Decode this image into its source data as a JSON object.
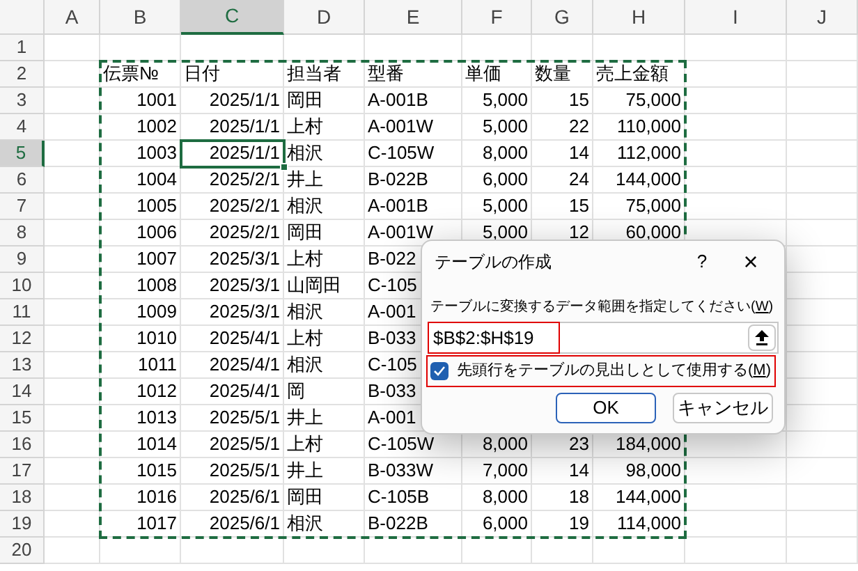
{
  "sheet": {
    "columns": [
      {
        "label": "A",
        "selected": false,
        "kind": "text"
      },
      {
        "label": "B",
        "selected": false,
        "kind": "number"
      },
      {
        "label": "C",
        "selected": true,
        "kind": "number"
      },
      {
        "label": "D",
        "selected": false,
        "kind": "text"
      },
      {
        "label": "E",
        "selected": false,
        "kind": "text"
      },
      {
        "label": "F",
        "selected": false,
        "kind": "number"
      },
      {
        "label": "G",
        "selected": false,
        "kind": "number"
      },
      {
        "label": "H",
        "selected": false,
        "kind": "number"
      },
      {
        "label": "I",
        "selected": false,
        "kind": "text"
      },
      {
        "label": "J",
        "selected": false,
        "kind": "text"
      }
    ],
    "copy_marquee": true,
    "rows": [
      {
        "header": "1",
        "selected": false,
        "kind": "data",
        "cells": []
      },
      {
        "header": "2",
        "selected": false,
        "kind": "header",
        "cells": [
          "",
          "伝票№",
          "日付",
          "担当者",
          "型番",
          "単価",
          "数量",
          "売上金額"
        ]
      },
      {
        "header": "3",
        "selected": false,
        "kind": "data",
        "cells": [
          "",
          "1001",
          "2025/1/1",
          "岡田",
          "A-001B",
          "5,000",
          "15",
          "75,000"
        ]
      },
      {
        "header": "4",
        "selected": false,
        "kind": "data",
        "cells": [
          "",
          "1002",
          "2025/1/1",
          "上村",
          "A-001W",
          "5,000",
          "22",
          "110,000"
        ]
      },
      {
        "header": "5",
        "selected": true,
        "kind": "data",
        "cells": [
          "",
          "1003",
          "2025/1/1",
          "相沢",
          "C-105W",
          "8,000",
          "14",
          "112,000"
        ]
      },
      {
        "header": "6",
        "selected": false,
        "kind": "data",
        "cells": [
          "",
          "1004",
          "2025/2/1",
          "井上",
          "B-022B",
          "6,000",
          "24",
          "144,000"
        ]
      },
      {
        "header": "7",
        "selected": false,
        "kind": "data",
        "cells": [
          "",
          "1005",
          "2025/2/1",
          "相沢",
          "A-001B",
          "5,000",
          "15",
          "75,000"
        ]
      },
      {
        "header": "8",
        "selected": false,
        "kind": "data",
        "cells": [
          "",
          "1006",
          "2025/2/1",
          "岡田",
          "A-001W",
          "5,000",
          "12",
          "60,000"
        ]
      },
      {
        "header": "9",
        "selected": false,
        "kind": "data",
        "cells": [
          "",
          "1007",
          "2025/3/1",
          "上村",
          "B-022"
        ]
      },
      {
        "header": "10",
        "selected": false,
        "kind": "data",
        "cells": [
          "",
          "1008",
          "2025/3/1",
          "山岡田",
          "C-105"
        ]
      },
      {
        "header": "11",
        "selected": false,
        "kind": "data",
        "cells": [
          "",
          "1009",
          "2025/3/1",
          "相沢",
          "A-001"
        ]
      },
      {
        "header": "12",
        "selected": false,
        "kind": "data",
        "cells": [
          "",
          "1010",
          "2025/4/1",
          "上村",
          "B-033"
        ]
      },
      {
        "header": "13",
        "selected": false,
        "kind": "data",
        "cells": [
          "",
          "1011",
          "2025/4/1",
          "相沢",
          "C-105"
        ]
      },
      {
        "header": "14",
        "selected": false,
        "kind": "data",
        "cells": [
          "",
          "1012",
          "2025/4/1",
          "岡",
          "B-033"
        ]
      },
      {
        "header": "15",
        "selected": false,
        "kind": "data",
        "cells": [
          "",
          "1013",
          "2025/5/1",
          "井上",
          "A-001"
        ]
      },
      {
        "header": "16",
        "selected": false,
        "kind": "data",
        "cells": [
          "",
          "1014",
          "2025/5/1",
          "上村",
          "C-105W",
          "8,000",
          "23",
          "184,000"
        ]
      },
      {
        "header": "17",
        "selected": false,
        "kind": "data",
        "cells": [
          "",
          "1015",
          "2025/5/1",
          "井上",
          "B-033W",
          "7,000",
          "14",
          "98,000"
        ]
      },
      {
        "header": "18",
        "selected": false,
        "kind": "data",
        "cells": [
          "",
          "1016",
          "2025/6/1",
          "岡田",
          "C-105B",
          "8,000",
          "18",
          "144,000"
        ]
      },
      {
        "header": "19",
        "selected": false,
        "kind": "data",
        "cells": [
          "",
          "1017",
          "2025/6/1",
          "相沢",
          "B-022B",
          "6,000",
          "19",
          "114,000"
        ]
      },
      {
        "header": "20",
        "selected": false,
        "kind": "data",
        "cells": []
      }
    ]
  },
  "dialog": {
    "title": "テーブルの作成",
    "help": "?",
    "close": "×",
    "prompt": {
      "text": "テーブルに変換するデータ範囲を指定してください(",
      "mnemonic": "W",
      "text_after": ")"
    },
    "range_field": {
      "value": "$B$2:$H$19",
      "highlighted": true
    },
    "header_checkbox": {
      "text": "先頭行をテーブルの見出しとして使用する(",
      "mnemonic": "M",
      "text_after": ")",
      "checked": true,
      "highlighted": true
    },
    "buttons": [
      {
        "label": "OK",
        "kind": "primary"
      },
      {
        "label": "キャンセル",
        "kind": "secondary"
      }
    ]
  }
}
